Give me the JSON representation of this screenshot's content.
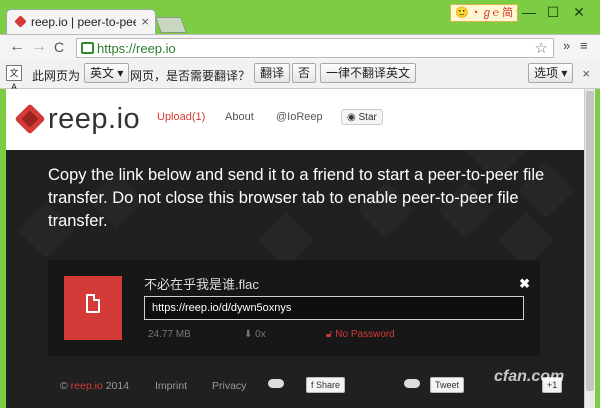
{
  "browser": {
    "tab_title": "reep.io | peer-to-peer f",
    "tab_close": "×",
    "ime_badge": "🙂 ◔ ℊ℮ 简 金",
    "window_controls": {
      "minimize": "—",
      "maximize": "☐",
      "close": "✕"
    },
    "nav": {
      "back": "←",
      "forward": "→",
      "reload": "C"
    },
    "address": "https://reep.io",
    "star": "☆",
    "menu_extra": "»",
    "menu": "≡"
  },
  "translate_bar": {
    "icon": "文A",
    "prefix": "此网页为",
    "language": "英文 ▾",
    "question": "网页，是否需要翻译？",
    "translate_btn": "翻译",
    "no_btn": "否",
    "never_btn": "一律不翻译英文",
    "options_btn": "选项 ▾",
    "close": "×"
  },
  "site": {
    "logo": "reep.io",
    "nav": {
      "upload": "Upload(1)",
      "about": "About",
      "twitter": "@IoReep",
      "star": "Star"
    }
  },
  "hero": {
    "message": "Copy the link below and send it to a friend to start a peer-to-peer file transfer. Do not close this browser tab to enable peer-to-peer file transfer."
  },
  "file": {
    "name": "不必在乎我是谁.flac",
    "link": "https://reep.io/d/dywn5oxnys",
    "size": "24.77 MB",
    "downloads": "0x",
    "password": "No Password",
    "close": "✖"
  },
  "footer": {
    "copyright": "© reep.io 2014",
    "copyright_sign": "©",
    "brand": "reep.io",
    "year": "2014",
    "imprint": "Imprint",
    "privacy": "Privacy",
    "share": "f Share",
    "tweet": "Tweet",
    "plus": "+1"
  },
  "watermark": "cfan.com",
  "colors": {
    "accent": "#d23b37",
    "chrome_green": "#7ccd44",
    "page_dark": "#202020"
  }
}
